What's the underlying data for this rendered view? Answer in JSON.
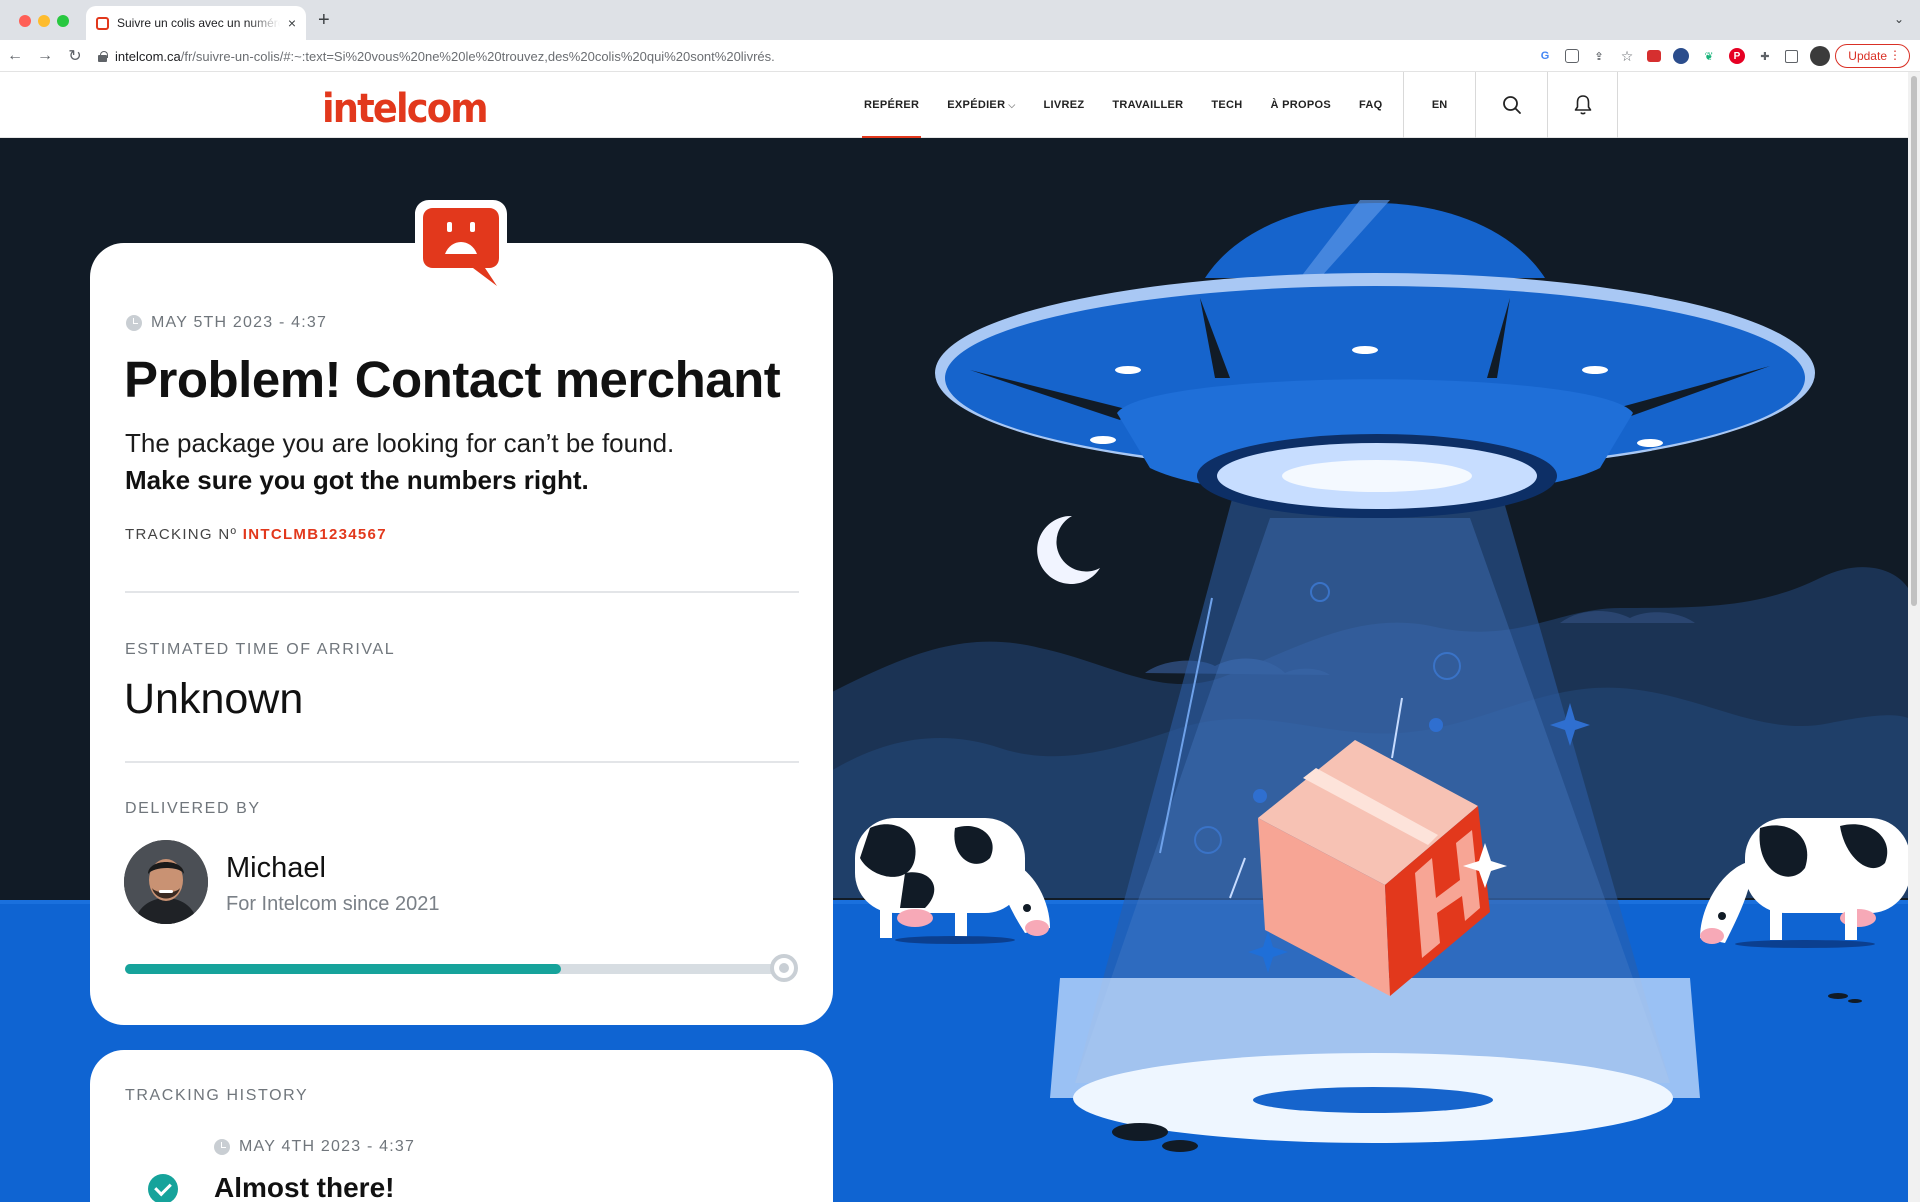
{
  "browser": {
    "tab_title": "Suivre un colis avec un numéro",
    "tab_close": "×",
    "new_tab": "+",
    "url_host": "intelcom.ca",
    "url_path": "/fr/suivre-un-colis/#:~:text=Si%20vous%20ne%20le%20trouvez,des%20colis%20qui%20sont%20livrés.",
    "update_label": "Update",
    "update_dots": "⋮"
  },
  "site": {
    "logo_text": "intelcom",
    "nav": [
      {
        "label": "REPÉRER",
        "active": true
      },
      {
        "label": "EXPÉDIER",
        "has_caret": true
      },
      {
        "label": "LIVREZ"
      },
      {
        "label": "TRAVAILLER"
      },
      {
        "label": "TECH"
      },
      {
        "label": "À PROPOS"
      },
      {
        "label": "FAQ"
      }
    ],
    "lang": "EN"
  },
  "status": {
    "timestamp": "MAY 5TH 2023 - 4:37",
    "title": "Problem! Contact merchant",
    "subtitle": "The package you are looking for can’t be found.",
    "emphasis": "Make sure you got the numbers right.",
    "tracking_label": "TRACKING Nº",
    "tracking_number": "INTCLMB1234567"
  },
  "eta": {
    "label": "ESTIMATED TIME OF ARRIVAL",
    "value": "Unknown"
  },
  "delivered_by": {
    "label": "DELIVERED BY",
    "driver_name": "Michael",
    "driver_since": "For Intelcom since 2021",
    "progress": 0.66
  },
  "history": {
    "label": "TRACKING HISTORY",
    "events": [
      {
        "timestamp": "MAY 4TH 2023 - 4:37",
        "title": "Almost there!"
      }
    ]
  },
  "colors": {
    "brand_red": "#e2381c",
    "progress_teal": "#16a39b",
    "night_sky": "#111b26",
    "ground_blue": "#0f64d2"
  }
}
